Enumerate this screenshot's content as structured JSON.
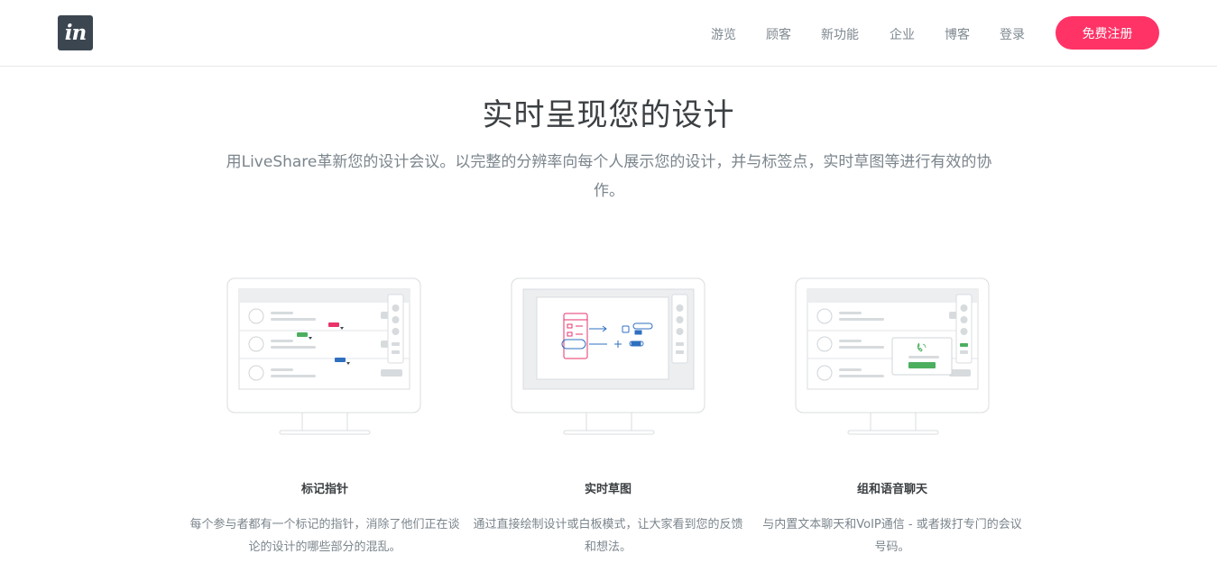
{
  "header": {
    "logo_text": "in",
    "nav": [
      {
        "label": "游览"
      },
      {
        "label": "顾客"
      },
      {
        "label": "新功能"
      },
      {
        "label": "企业"
      },
      {
        "label": "博客"
      },
      {
        "label": "登录"
      }
    ],
    "cta_label": "免费注册"
  },
  "hero": {
    "title": "实时呈现您的设计",
    "subtitle": "用LiveShare革新您的设计会议。以完整的分辨率向每个人展示您的设计，并与标签点，实时草图等进行有效的协作。"
  },
  "features": [
    {
      "title": "标记指针",
      "description": "每个参与者都有一个标记的指针，消除了他们正在谈论的设计的哪些部分的混乱。"
    },
    {
      "title": "实时草图",
      "description": "通过直接绘制设计或白板模式，让大家看到您的反馈和想法。"
    },
    {
      "title": "组和语音聊天",
      "description": "与内置文本聊天和VoIP通信 - 或者拨打专门的会议号码。"
    }
  ],
  "colors": {
    "accent": "#ff3366",
    "logo_bg": "#3b4651",
    "pointer_pink": "#e8336b",
    "pointer_green": "#4caf60",
    "pointer_blue": "#2f6fc0"
  }
}
